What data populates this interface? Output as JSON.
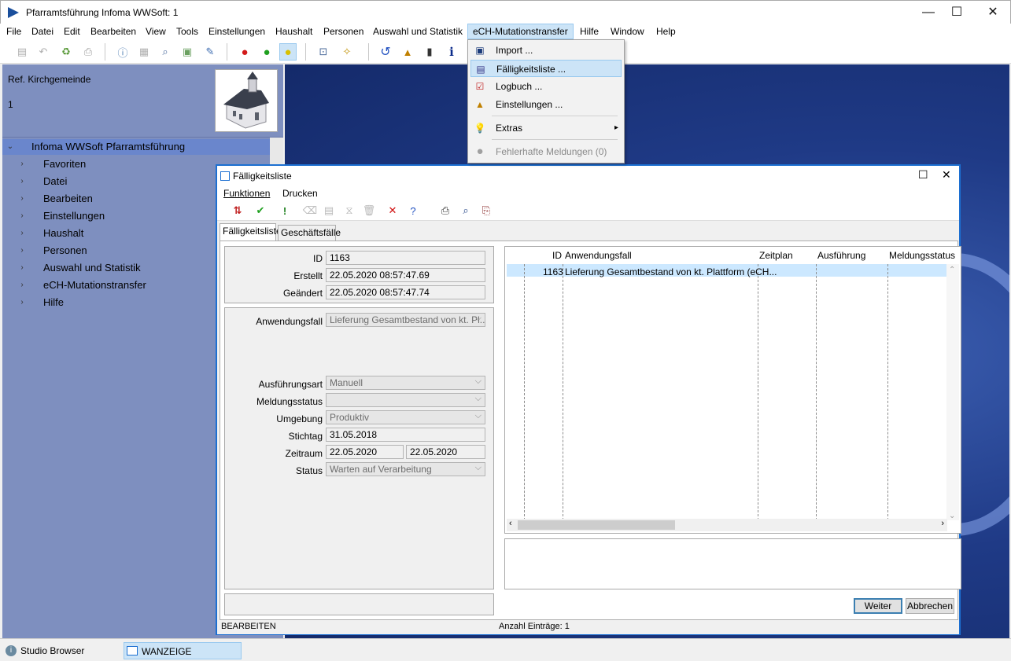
{
  "app": {
    "title": "Pfarramtsführung Infoma WWSoft:  1",
    "window_buttons": [
      "—",
      "☐",
      "✕"
    ]
  },
  "menubar": [
    "File",
    "Datei",
    "Edit",
    "Bearbeiten",
    "View",
    "Tools",
    "Einstellungen",
    "Haushalt",
    "Personen",
    "Auswahl und Statistik",
    "eCH-Mutationstransfer",
    "Hilfe",
    "Window",
    "Help"
  ],
  "dropdown": {
    "items": [
      {
        "label": "Import ...",
        "icon": "import-icon"
      },
      {
        "label": "Fälligkeitsliste ...",
        "icon": "list-icon"
      },
      {
        "label": "Logbuch ...",
        "icon": "logbook-icon"
      },
      {
        "label": "Einstellungen ...",
        "icon": "settings-icon"
      },
      {
        "label": "Extras",
        "icon": "lightbulb-icon",
        "submenu": "▸"
      },
      {
        "label": "Fehlerhafte Meldungen (0)",
        "icon": "disabled-circle-icon"
      }
    ]
  },
  "leftpanel": {
    "org": "Ref. Kirchgemeinde",
    "number": "1",
    "tree": {
      "root": "Infoma WWSoft Pfarramtsführung",
      "items": [
        "Favoriten",
        "Datei",
        "Bearbeiten",
        "Einstellungen",
        "Haushalt",
        "Personen",
        "Auswahl und Statistik",
        "eCH-Mutationstransfer",
        "Hilfe"
      ]
    }
  },
  "child": {
    "title": "Fälligkeitsliste",
    "menu": [
      "Funktionen",
      "Drucken"
    ],
    "tabs": [
      "Fälligkeitsliste",
      "Geschäftsfälle"
    ],
    "fields": {
      "id": {
        "label": "ID",
        "value": "1163"
      },
      "erstellt": {
        "label": "Erstellt",
        "value": "22.05.2020 08:57:47.69"
      },
      "geaendert": {
        "label": "Geändert",
        "value": "22.05.2020 08:57:47.74"
      },
      "anwendungsfall": {
        "label": "Anwendungsfall",
        "value": "Lieferung Gesamtbestand von kt. Pl..."
      },
      "ausfuehrungsart": {
        "label": "Ausführungsart",
        "value": "Manuell"
      },
      "meldungsstatus": {
        "label": "Meldungsstatus",
        "value": ""
      },
      "umgebung": {
        "label": "Umgebung",
        "value": "Produktiv"
      },
      "stichtag": {
        "label": "Stichtag",
        "value": "31.05.2018"
      },
      "zeitraum": {
        "label": "Zeitraum",
        "from": "22.05.2020",
        "to": "22.05.2020"
      },
      "status": {
        "label": "Status",
        "value": "Warten auf Verarbeitung"
      }
    },
    "grid": {
      "columns": [
        "ID",
        "Anwendungsfall",
        "Zeitplan",
        "Ausführung",
        "Meldungsstatus"
      ],
      "rows": [
        {
          "id": "1163",
          "anwendungsfall": "Lieferung Gesamtbestand von kt. Plattform (eCH...",
          "zeitplan": "",
          "ausfuehrung": "",
          "meldungsstatus": ""
        }
      ]
    },
    "buttons": {
      "weiter": "Weiter",
      "abbrechen": "Abbrechen"
    },
    "status": {
      "mode": "BEARBEITEN",
      "count": "Anzahl Einträge: 1"
    }
  },
  "taskbar": [
    "Studio Browser",
    "WANZEIGE"
  ]
}
